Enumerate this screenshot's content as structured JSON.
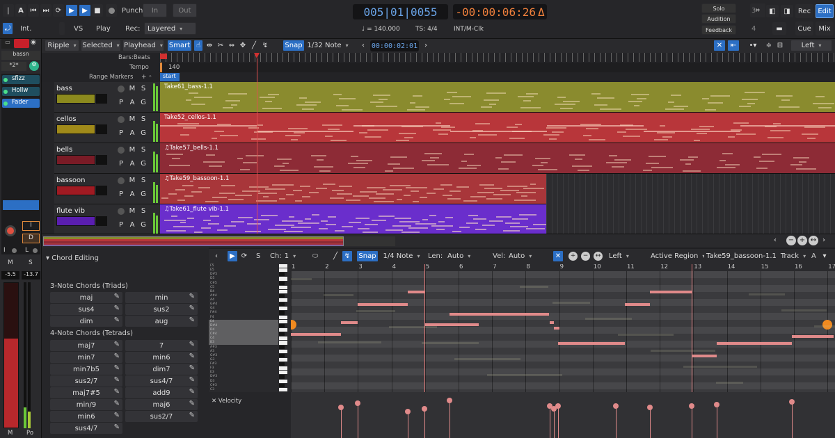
{
  "transport": {
    "punch": "Punch:",
    "in": "In",
    "out": "Out",
    "int": "Int.",
    "vs": "VS",
    "play": "Play",
    "rec": "Rec:",
    "rec_mode": "Layered",
    "tempo": "♩ = 140.000",
    "ts": "TS: 4/4",
    "clk": "INT/M-Clk",
    "bbt": "005|01|0055",
    "time": "-00:00:06:26",
    "delta": "Δ",
    "solo": "Solo",
    "audition": "Audition",
    "feedback": "Feedback",
    "num3": "3",
    "num4": "4",
    "rec_btn": "Rec",
    "edit_btn": "Edit",
    "cue_btn": "Cue",
    "mix_btn": "Mix"
  },
  "edit_toolbar": {
    "ripple": "Ripple",
    "selected": "Selected",
    "playhead": "Playhead",
    "smart": "Smart",
    "snap": "Snap",
    "grid": "1/32 Note",
    "nudge": "00:00:02:01",
    "left": "Left"
  },
  "left_strip": {
    "track": "bassn",
    "label2": "*2*",
    "plugins": [
      "sfizz",
      "Hollw",
      "Fader"
    ],
    "input": "I",
    "disk": "D",
    "il": "I",
    "ll": "L",
    "m": "M",
    "s": "S",
    "val1": "-5.5",
    "val2": "-13.7",
    "mb": "M",
    "po": "Po"
  },
  "rulers": {
    "bars": "Bars:Beats",
    "tempo": "Tempo",
    "ranges": "Range Markers",
    "tempo_val": "140",
    "start": "start"
  },
  "tracks": [
    {
      "name": "bass",
      "region": "Take61_bass-1.1",
      "color": "#8c8a1e",
      "lane": "#8a8b2e"
    },
    {
      "name": "cellos",
      "region": "Take52_cellos-1.1",
      "color": "#a08a1a",
      "lane": "#b8363a"
    },
    {
      "name": "bells",
      "region": "♫Take57_bells-1.1",
      "color": "#7a1b26",
      "lane": "#8d2b36"
    },
    {
      "name": "bassoon",
      "region": "♫Take59_bassoon-1.1",
      "color": "#a01a22",
      "lane": "#a8363a"
    },
    {
      "name": "flute vib",
      "region": "♫Take61_flute vib-1.1",
      "color": "#5a1eb0",
      "lane": "#6a2ecc"
    }
  ],
  "track_buttons": {
    "m": "M",
    "s": "S",
    "p": "P",
    "a": "A",
    "g": "G"
  },
  "chord_panel": {
    "title": "Chord Editing",
    "triads_title": "3-Note Chords (Triads)",
    "tetrads_title": "4-Note Chords (Tetrads)",
    "triads": [
      "maj",
      "min",
      "sus4",
      "sus2",
      "dim",
      "aug"
    ],
    "tetrads": [
      "maj7",
      "7",
      "min7",
      "min6",
      "min7b5",
      "dim7",
      "sus2/7",
      "sus4/7",
      "maj7#5",
      "add9",
      "min/9",
      "maj6",
      "min6",
      "sus2/7",
      "sus4/7"
    ]
  },
  "midi_toolbar": {
    "s": "S",
    "ch": "Ch:",
    "ch_val": "1",
    "snap": "Snap",
    "grid": "1/4 Note",
    "len": "Len:",
    "len_val": "Auto",
    "vel": "Vel:",
    "vel_val": "Auto",
    "left": "Left",
    "active": "Active Region",
    "region": "Take59_bassoon-1.1",
    "track": "Track",
    "a": "A"
  },
  "roll_ruler": [
    "1",
    "2",
    "3",
    "4",
    "5",
    "6",
    "7",
    "8",
    "9",
    "10",
    "11",
    "12",
    "13",
    "14",
    "15",
    "16",
    "17"
  ],
  "velocity_label": "Velocity"
}
